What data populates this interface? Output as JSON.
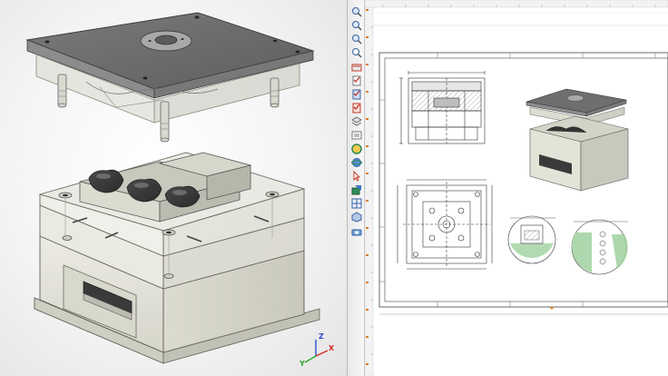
{
  "viewport": {
    "name": "3d-viewport",
    "axes": {
      "z": "Z",
      "y": "Y",
      "x": "X"
    },
    "colors": {
      "x_axis": "#d22a2a",
      "y_axis": "#2fa52f",
      "z_axis": "#2a4fd2",
      "mold_plate": "#e4e3d8",
      "top_plate": "#6e6e6e"
    }
  },
  "toolbar": {
    "tools": [
      {
        "icon": "zoom-in-icon"
      },
      {
        "icon": "zoom-out-icon"
      },
      {
        "icon": "zoom-window-icon"
      },
      {
        "icon": "zoom-all-icon"
      },
      {
        "icon": "view-block-icon"
      },
      {
        "icon": "checklist-icon"
      },
      {
        "icon": "checklist-blue-icon"
      },
      {
        "icon": "checklist-red-icon"
      },
      {
        "icon": "layers-icon"
      },
      {
        "icon": "properties-icon"
      },
      {
        "icon": "sphere-icon"
      },
      {
        "icon": "orbit-icon"
      },
      {
        "icon": "pointer-icon"
      },
      {
        "icon": "fill-icon"
      },
      {
        "icon": "grid-icon"
      },
      {
        "icon": "solid-icon"
      },
      {
        "icon": "camera-icon"
      }
    ]
  },
  "drawing": {
    "name": "drawing-sheet",
    "views": [
      "section-view",
      "isometric-view",
      "top-view",
      "detail-view-1",
      "detail-view-2"
    ]
  }
}
